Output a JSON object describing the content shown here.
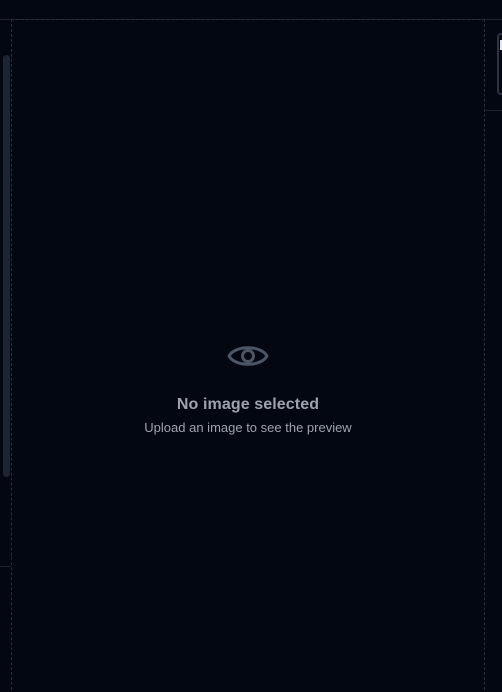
{
  "preview": {
    "empty_title": "No image selected",
    "empty_subtitle": "Upload an image to see the preview",
    "icon": "eye-icon"
  },
  "colors": {
    "background": "#030712",
    "border": "#263041",
    "text_muted": "#9ca3af",
    "icon": "#4b5563"
  }
}
